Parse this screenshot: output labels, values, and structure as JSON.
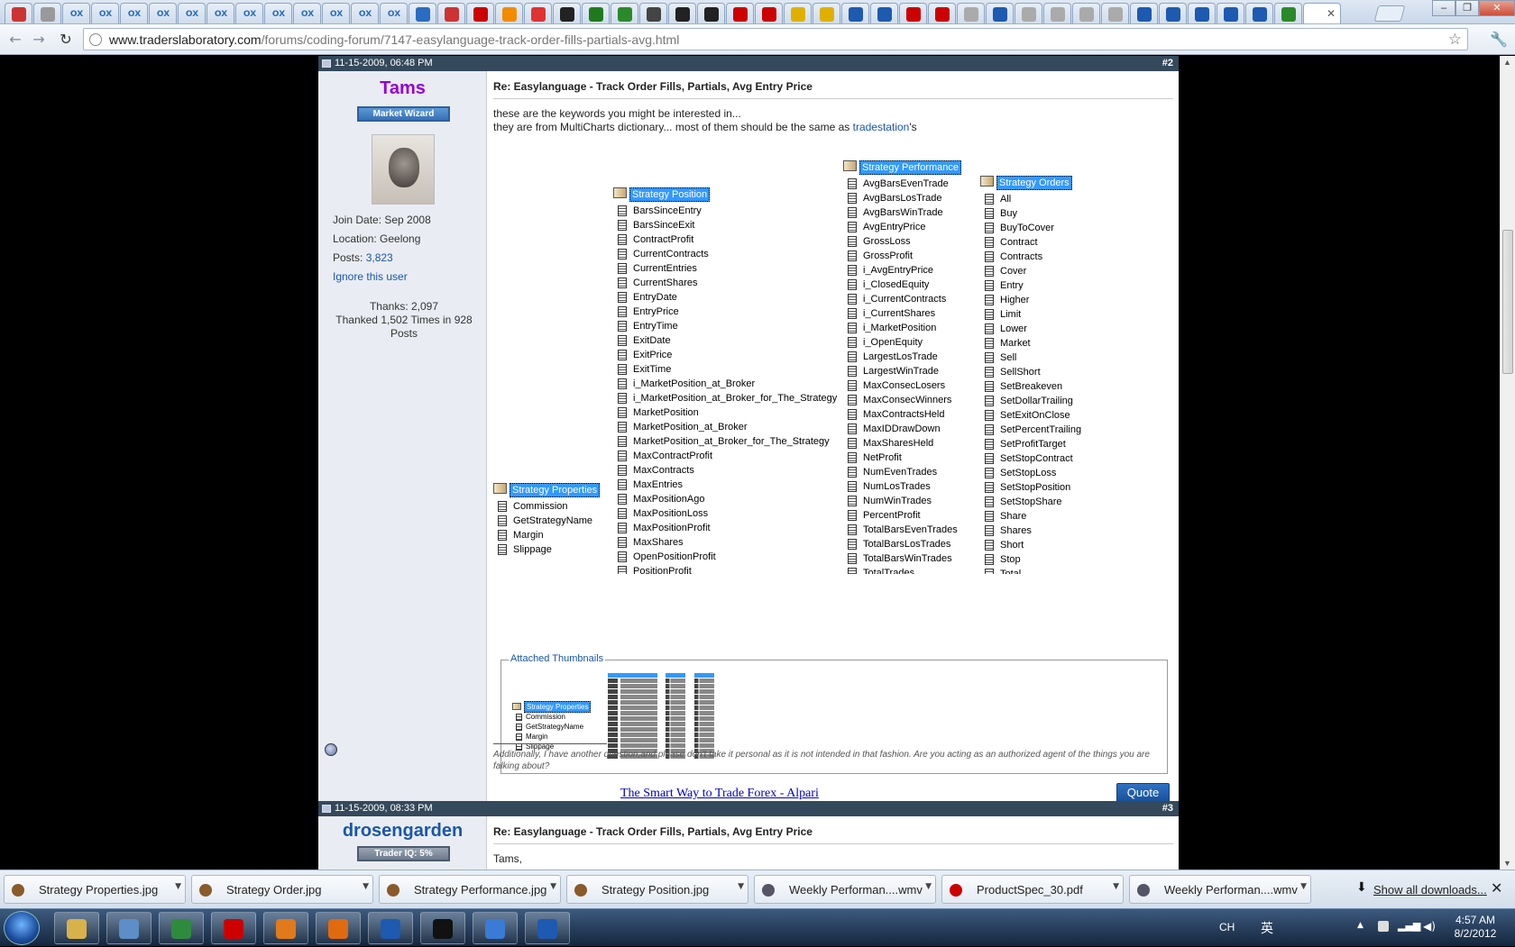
{
  "browser": {
    "url_domain": "www.traderslaboratory.com",
    "url_path": "/forums/coding-forum/7147-easylanguage-track-order-fills-partials-avg.html",
    "tab_labels": [
      "OX",
      "OX",
      "OX",
      "OX",
      "OX",
      "OX",
      "OX",
      "OX",
      "OX",
      "OX",
      "OX",
      "OX"
    ],
    "tab_colors": [
      "#c33",
      "#999",
      "#2a6cbf",
      "#2a6cbf",
      "#2a6cbf",
      "#2a6cbf",
      "#2a6cbf",
      "#2a6cbf",
      "#2a6cbf",
      "#2a6cbf",
      "#2a6cbf",
      "#2a6cbf",
      "#2a6cbf",
      "#2a6cbf",
      "#2a6cbf",
      "#c33",
      "#c00",
      "#f28b00",
      "#d33",
      "#222",
      "#1f7a1f",
      "#2a8a2a",
      "#444",
      "#222",
      "#222",
      "#c00",
      "#c00",
      "#e0b000",
      "#e0b000",
      "#1d5ab0",
      "#1d5ab0",
      "#c00",
      "#c00",
      "#aaa",
      "#1d5ab0",
      "#aaa",
      "#aaa",
      "#aaa",
      "#aaa",
      "#1d5ab0",
      "#1d5ab0",
      "#1d5ab0",
      "#1d5ab0",
      "#1d5ab0",
      "#2a8a2a"
    ]
  },
  "post2": {
    "date": "11-15-2009, 06:48 PM",
    "number": "#2",
    "username": "Tams",
    "rank": "Market Wizard",
    "join_date": "Join Date: Sep 2008",
    "location": "Location: Geelong",
    "posts_label": "Posts:",
    "posts_value": "3,823",
    "ignore": "Ignore this user",
    "thanks": "Thanks: 2,097",
    "thanked": "Thanked 1,502 Times in 928",
    "thanked_posts": "Posts",
    "title": "Re: Easylanguage - Track Order Fills, Partials, Avg Entry Price",
    "line1": "these are the keywords you might be interested in...",
    "line2_pre": "they are from MultiCharts dictionary... most of them should be the same as",
    "line2_link": "tradestation",
    "line2_post": "'s",
    "attached_thumbnails": "Attached Thumbnails",
    "signature": "Additionally, I have another question,and please don't take it personal as it is not intended in that fashion. Are you acting as an authorized agent of the things you are falking about?",
    "ad": "The Smart Way to Trade Forex - Alpari",
    "quote": "Quote"
  },
  "trees": {
    "properties": {
      "root": "Strategy Properties",
      "items": [
        "Commission",
        "GetStrategyName",
        "Margin",
        "Slippage"
      ]
    },
    "position": {
      "root": "Strategy Position",
      "items": [
        "BarsSinceEntry",
        "BarsSinceExit",
        "ContractProfit",
        "CurrentContracts",
        "CurrentEntries",
        "CurrentShares",
        "EntryDate",
        "EntryPrice",
        "EntryTime",
        "ExitDate",
        "ExitPrice",
        "ExitTime",
        "i_MarketPosition_at_Broker",
        "i_MarketPosition_at_Broker_for_The_Strategy",
        "MarketPosition",
        "MarketPosition_at_Broker",
        "MarketPosition_at_Broker_for_The_Strategy",
        "MaxContractProfit",
        "MaxContracts",
        "MaxEntries",
        "MaxPositionAgo",
        "MaxPositionLoss",
        "MaxPositionProfit",
        "MaxShares",
        "OpenPositionProfit",
        "PositionProfit"
      ]
    },
    "performance": {
      "root": "Strategy Performance",
      "items": [
        "AvgBarsEvenTrade",
        "AvgBarsLosTrade",
        "AvgBarsWinTrade",
        "AvgEntryPrice",
        "GrossLoss",
        "GrossProfit",
        "i_AvgEntryPrice",
        "i_ClosedEquity",
        "i_CurrentContracts",
        "i_CurrentShares",
        "i_MarketPosition",
        "i_OpenEquity",
        "LargestLosTrade",
        "LargestWinTrade",
        "MaxConsecLosers",
        "MaxConsecWinners",
        "MaxContractsHeld",
        "MaxIDDrawDown",
        "MaxSharesHeld",
        "NetProfit",
        "NumEvenTrades",
        "NumLosTrades",
        "NumWinTrades",
        "PercentProfit",
        "TotalBarsEvenTrades",
        "TotalBarsLosTrades",
        "TotalBarsWinTrades",
        "TotalTrades"
      ]
    },
    "orders": {
      "root": "Strategy Orders",
      "items": [
        "All",
        "Buy",
        "BuyToCover",
        "Contract",
        "Contracts",
        "Cover",
        "Entry",
        "Higher",
        "Limit",
        "Lower",
        "Market",
        "Sell",
        "SellShort",
        "SetBreakeven",
        "SetDollarTrailing",
        "SetExitOnClose",
        "SetPercentTrailing",
        "SetProfitTarget",
        "SetStopContract",
        "SetStopLoss",
        "SetStopPosition",
        "SetStopShare",
        "Share",
        "Shares",
        "Short",
        "Stop",
        "Total"
      ]
    }
  },
  "post3": {
    "date": "11-15-2009, 08:33 PM",
    "number": "#3",
    "username": "drosengarden",
    "rank": "Trader IQ: 5%",
    "title": "Re: Easylanguage - Track Order Fills, Partials, Avg Entry Price",
    "text": "Tams,"
  },
  "downloads": {
    "items": [
      {
        "name": "Strategy Properties.jpg",
        "color": "#8a5a2a"
      },
      {
        "name": "Strategy Order.jpg",
        "color": "#8a5a2a"
      },
      {
        "name": "Strategy Performance.jpg",
        "color": "#8a5a2a"
      },
      {
        "name": "Strategy Position.jpg",
        "color": "#8a5a2a"
      },
      {
        "name": "Weekly Performan....wmv",
        "color": "#556"
      },
      {
        "name": "ProductSpec_30.pdf",
        "color": "#c00"
      },
      {
        "name": "Weekly Performan....wmv",
        "color": "#556"
      }
    ],
    "show_all": "Show all downloads...",
    "close": "✕"
  },
  "taskbar": {
    "lang": "CH",
    "ime": "英",
    "time": "4:57 AM",
    "date": "8/2/2012",
    "icon_colors": [
      "#d7b24a",
      "#5d8ec5",
      "#2e8b3e",
      "#c00",
      "#e07a1a",
      "#e06a10",
      "#1d5ab0",
      "#111",
      "#3a7bd5",
      "#1d5ab0"
    ]
  },
  "colors": {
    "post_header": "#34495b",
    "username_tams": "#9400d3",
    "username_dros": "#1a56a8",
    "link": "#1a56a8",
    "selection": "#3399ff"
  }
}
